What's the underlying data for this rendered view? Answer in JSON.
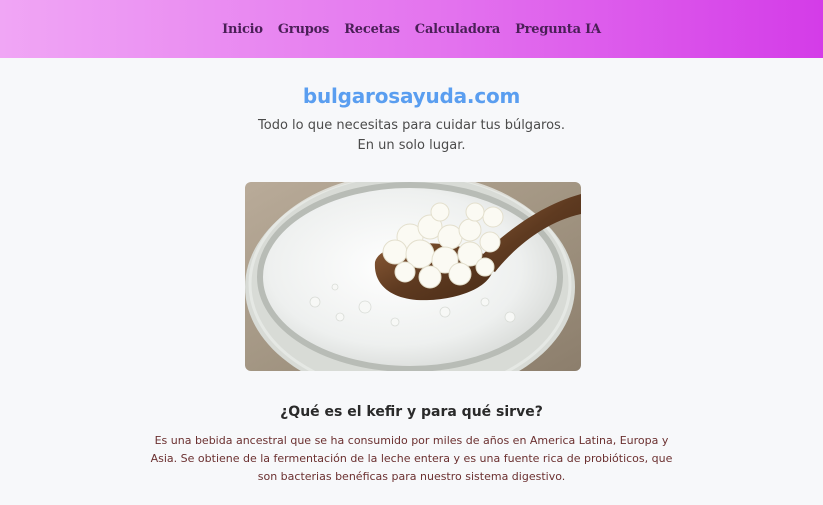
{
  "nav": {
    "items": [
      {
        "label": "Inicio"
      },
      {
        "label": "Grupos"
      },
      {
        "label": "Recetas"
      },
      {
        "label": "Calculadora"
      },
      {
        "label": "Pregunta IA"
      }
    ]
  },
  "hero": {
    "title": "bulgarosayuda.com",
    "tagline_line1": "Todo lo que necesitas para cuidar tus búlgaros.",
    "tagline_line2": "En un solo lugar."
  },
  "section": {
    "title": "¿Qué es el kefir y para qué sirve?",
    "body": "Es una bebida ancestral que se ha consumido por miles de años en America Latina, Europa y Asia. Se obtiene de la fermentación de la leche entera y es una fuente rica de probióticos, que son bacterias benéficas para nuestro sistema digestivo."
  },
  "colors": {
    "accent": "#5a9ef0",
    "nav_gradient_start": "#f0a6f5",
    "nav_gradient_end": "#d43ce8",
    "nav_text": "#4a1f57",
    "body_text": "#6b3030"
  }
}
